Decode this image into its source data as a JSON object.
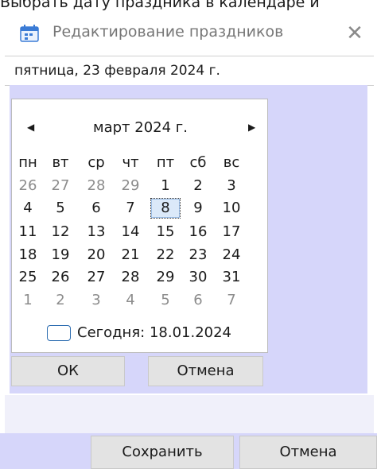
{
  "caption_text": "Выбрать дату праздника в календаре и",
  "window": {
    "title": "Редактирование праздников",
    "close_glyph": "✕",
    "app_icon": "calendar-icon"
  },
  "date_field": {
    "value": "пятница, 23 февраля 2024 г."
  },
  "calendar": {
    "month_label": "март 2024 г.",
    "prev_glyph": "◀",
    "next_glyph": "▶",
    "day_names": [
      "пн",
      "вт",
      "ср",
      "чт",
      "пт",
      "сб",
      "вс"
    ],
    "weeks": [
      [
        {
          "d": "26",
          "o": true
        },
        {
          "d": "27",
          "o": true
        },
        {
          "d": "28",
          "o": true
        },
        {
          "d": "29",
          "o": true
        },
        {
          "d": "1"
        },
        {
          "d": "2"
        },
        {
          "d": "3"
        }
      ],
      [
        {
          "d": "4"
        },
        {
          "d": "5"
        },
        {
          "d": "6"
        },
        {
          "d": "7"
        },
        {
          "d": "8",
          "sel": true
        },
        {
          "d": "9"
        },
        {
          "d": "10"
        }
      ],
      [
        {
          "d": "11"
        },
        {
          "d": "12"
        },
        {
          "d": "13"
        },
        {
          "d": "14"
        },
        {
          "d": "15"
        },
        {
          "d": "16"
        },
        {
          "d": "17"
        }
      ],
      [
        {
          "d": "18"
        },
        {
          "d": "19"
        },
        {
          "d": "20"
        },
        {
          "d": "21"
        },
        {
          "d": "22"
        },
        {
          "d": "23"
        },
        {
          "d": "24"
        }
      ],
      [
        {
          "d": "25"
        },
        {
          "d": "26"
        },
        {
          "d": "27"
        },
        {
          "d": "28"
        },
        {
          "d": "29"
        },
        {
          "d": "30"
        },
        {
          "d": "31"
        }
      ],
      [
        {
          "d": "1",
          "o": true
        },
        {
          "d": "2",
          "o": true
        },
        {
          "d": "3",
          "o": true
        },
        {
          "d": "4",
          "o": true
        },
        {
          "d": "5",
          "o": true
        },
        {
          "d": "6",
          "o": true
        },
        {
          "d": "7",
          "o": true
        }
      ]
    ],
    "today_label": "Сегодня: 18.01.2024",
    "ok_label": "ОК",
    "cancel_label": "Отмена"
  },
  "footer": {
    "save_label": "Сохранить",
    "cancel_label": "Отмена"
  },
  "colors": {
    "panel": "#d6d6fa",
    "button": "#e3e3e3",
    "today_border": "#2b6cb0",
    "icon_accent": "#3a7bd5"
  }
}
